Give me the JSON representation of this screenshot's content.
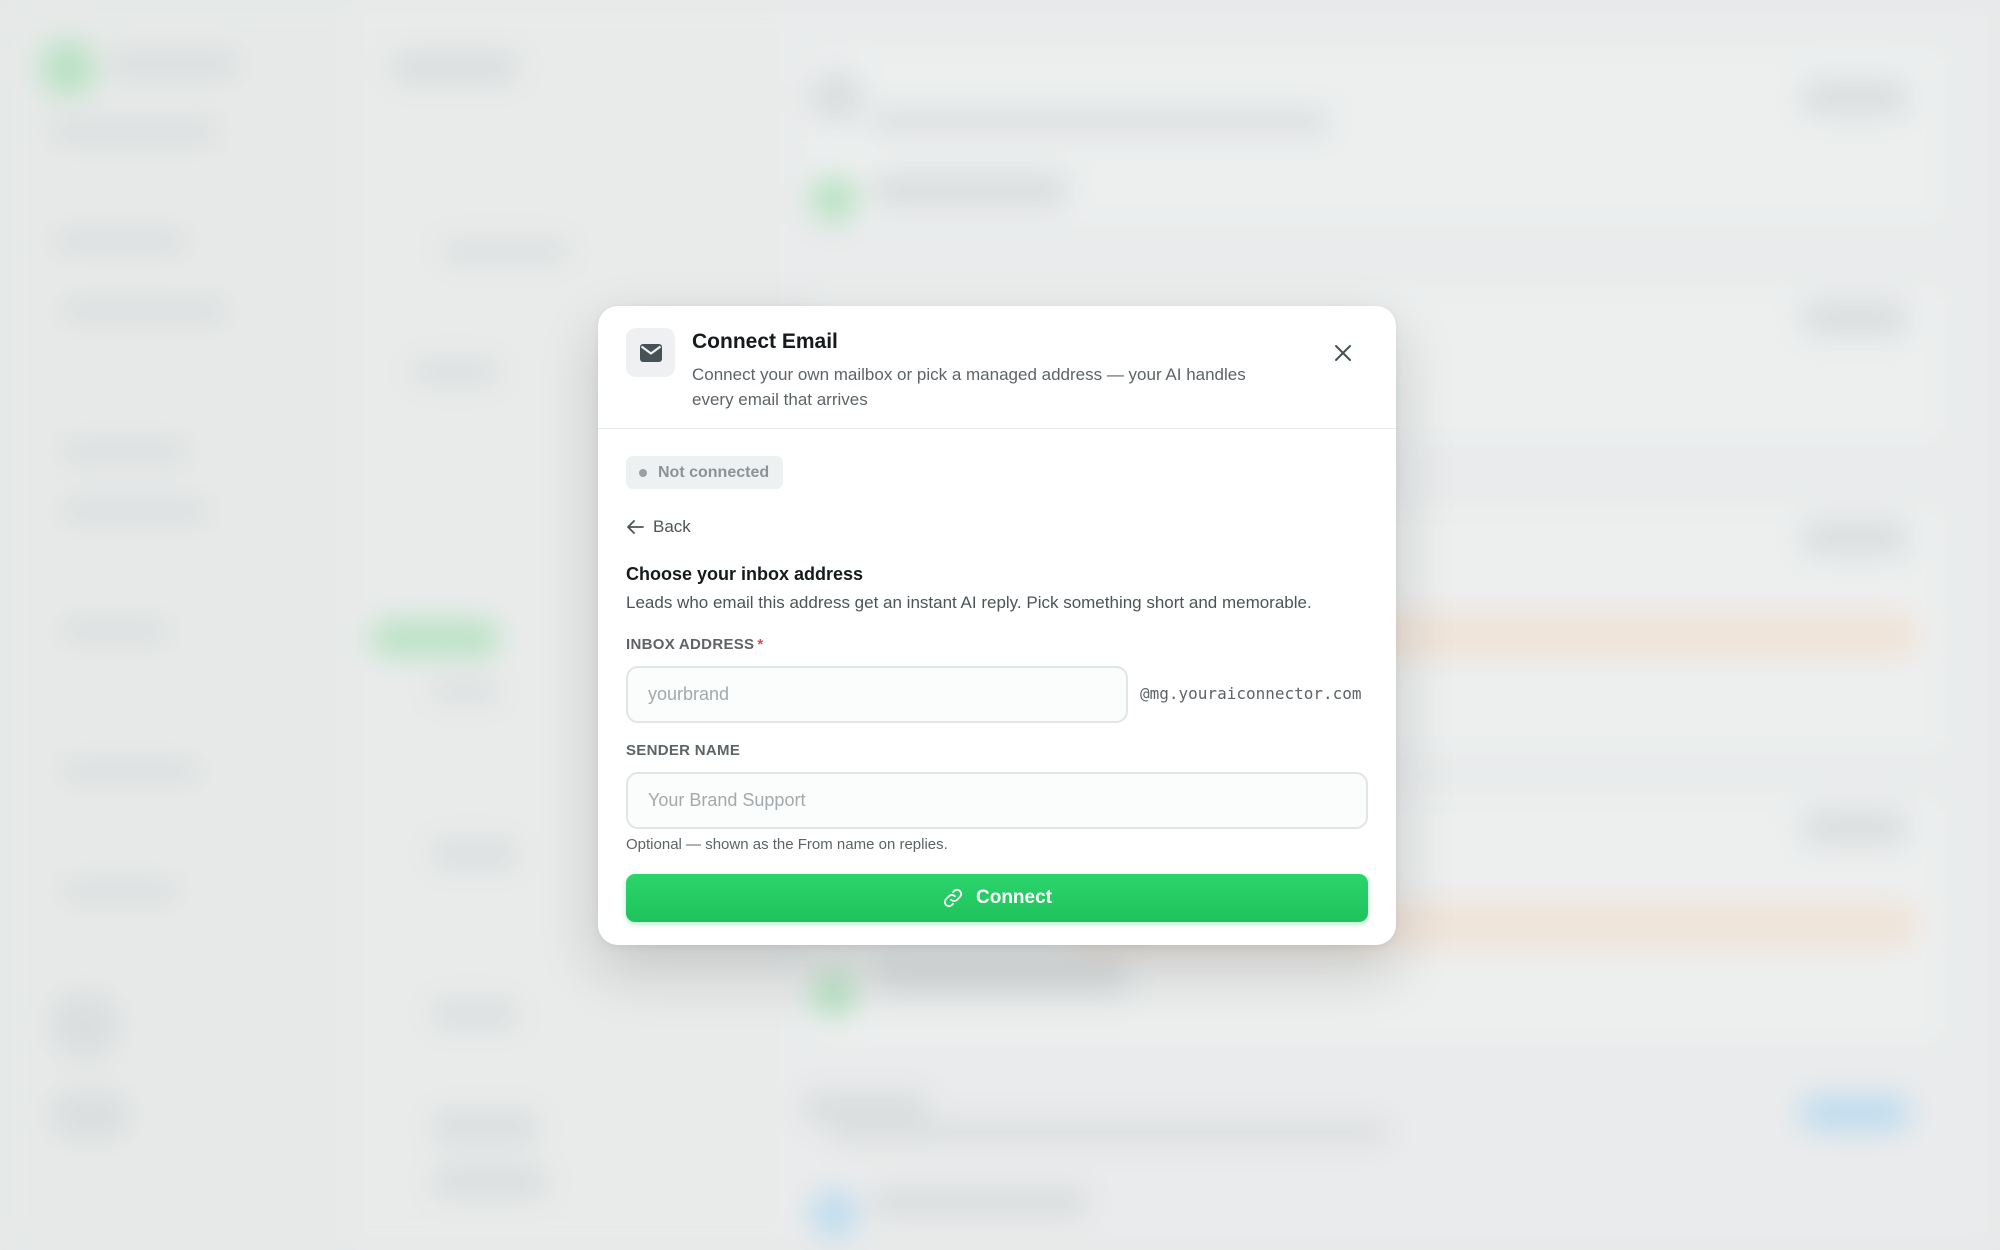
{
  "modal": {
    "title": "Connect Email",
    "subtitle": "Connect your own mailbox or pick a managed address — your AI handles every email that arrives",
    "header_icon": "mail-icon",
    "close_icon": "close-icon"
  },
  "status": {
    "label": "Not connected",
    "color": "#9aa1a4"
  },
  "back": {
    "label": "Back",
    "icon": "arrow-left-icon"
  },
  "inbox_section": {
    "title": "Choose your inbox address",
    "description": "Leads who email this address get an instant AI reply. Pick something short and memorable."
  },
  "inbox_address": {
    "label": "INBOX ADDRESS",
    "required_marker": "*",
    "value": "",
    "placeholder": "yourbrand",
    "suffix": "@mg.youraiconnector.com"
  },
  "sender_name": {
    "label": "SENDER NAME",
    "value": "",
    "placeholder": "Your Brand Support",
    "hint": "Optional — shown as the From name on replies."
  },
  "connect_button": {
    "label": "Connect",
    "icon": "link-icon",
    "color": "#22c55e"
  }
}
